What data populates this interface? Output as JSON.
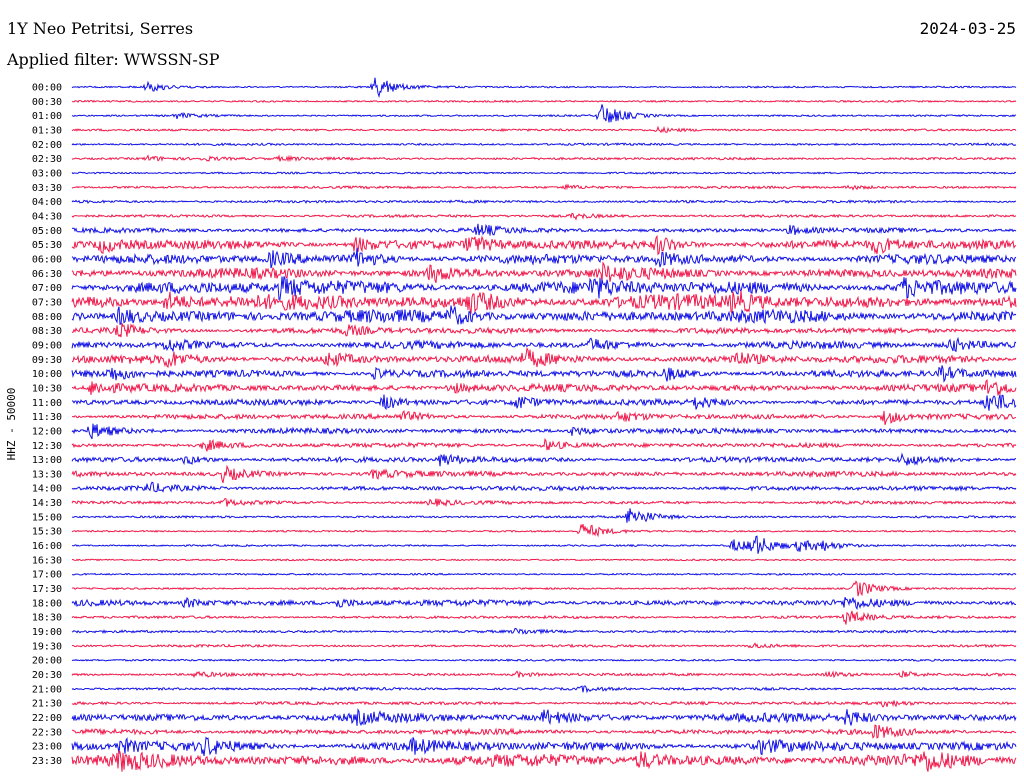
{
  "header": {
    "station": "1Y Neo Petritsi, Serres",
    "date": "2024-03-25",
    "filter": "Applied filter: WWSSN-SP"
  },
  "colors": {
    "even_trace": "#1010e6",
    "odd_trace": "#f0184a",
    "text": "#000000",
    "background": "#ffffff"
  },
  "chart_data": {
    "type": "line",
    "title": "1Y Neo Petritsi, Serres",
    "ylabel": "HHZ - 50000",
    "xlabel": "",
    "grid": false,
    "legend": "none",
    "series": [
      {
        "row_label": "00:00",
        "activity": 0.05,
        "events": [
          [
            0.08,
            1.0
          ],
          [
            0.32,
            2.5
          ]
        ]
      },
      {
        "row_label": "00:30",
        "activity": 0.05,
        "events": []
      },
      {
        "row_label": "01:00",
        "activity": 0.05,
        "events": [
          [
            0.11,
            0.6
          ],
          [
            0.56,
            2.8
          ]
        ]
      },
      {
        "row_label": "01:30",
        "activity": 0.08,
        "events": [
          [
            0.62,
            0.5
          ]
        ]
      },
      {
        "row_label": "02:00",
        "activity": 0.08,
        "events": []
      },
      {
        "row_label": "02:30",
        "activity": 0.1,
        "events": [
          [
            0.08,
            0.5
          ],
          [
            0.14,
            0.4
          ],
          [
            0.22,
            0.4
          ]
        ]
      },
      {
        "row_label": "03:00",
        "activity": 0.06,
        "events": []
      },
      {
        "row_label": "03:30",
        "activity": 0.1,
        "events": [
          [
            0.52,
            0.5
          ],
          [
            0.82,
            0.5
          ]
        ]
      },
      {
        "row_label": "04:00",
        "activity": 0.12,
        "events": []
      },
      {
        "row_label": "04:30",
        "activity": 0.12,
        "events": [
          [
            0.53,
            0.6
          ]
        ]
      },
      {
        "row_label": "05:00",
        "activity": 0.25,
        "events": [
          [
            0.43,
            1.2
          ],
          [
            0.76,
            1.0
          ]
        ]
      },
      {
        "row_label": "05:30",
        "activity": 0.6,
        "events": [
          [
            0.03,
            1.4
          ],
          [
            0.3,
            1.6
          ],
          [
            0.42,
            1.8
          ],
          [
            0.62,
            1.8
          ],
          [
            0.85,
            1.6
          ]
        ]
      },
      {
        "row_label": "06:00",
        "activity": 0.6,
        "events": [
          [
            0.21,
            1.4
          ],
          [
            0.3,
            2.0
          ],
          [
            0.62,
            1.6
          ]
        ]
      },
      {
        "row_label": "06:30",
        "activity": 0.65,
        "events": [
          [
            0.38,
            1.8
          ],
          [
            0.56,
            1.6
          ]
        ]
      },
      {
        "row_label": "07:00",
        "activity": 0.9,
        "events": [
          [
            0.22,
            2.0
          ],
          [
            0.55,
            1.8
          ],
          [
            0.88,
            2.0
          ]
        ]
      },
      {
        "row_label": "07:30",
        "activity": 1.0,
        "events": [
          [
            0.1,
            2.2
          ],
          [
            0.42,
            2.2
          ],
          [
            0.7,
            2.2
          ]
        ]
      },
      {
        "row_label": "08:00",
        "activity": 0.85,
        "events": [
          [
            0.05,
            1.8
          ],
          [
            0.4,
            1.8
          ]
        ]
      },
      {
        "row_label": "08:30",
        "activity": 0.35,
        "events": [
          [
            0.05,
            1.4
          ],
          [
            0.29,
            1.0
          ]
        ]
      },
      {
        "row_label": "09:00",
        "activity": 0.45,
        "events": [
          [
            0.1,
            1.4
          ],
          [
            0.55,
            1.2
          ],
          [
            0.93,
            1.4
          ]
        ]
      },
      {
        "row_label": "09:30",
        "activity": 0.5,
        "events": [
          [
            0.1,
            1.6
          ],
          [
            0.27,
            1.4
          ],
          [
            0.48,
            1.6
          ],
          [
            0.7,
            1.6
          ]
        ]
      },
      {
        "row_label": "10:00",
        "activity": 0.45,
        "events": [
          [
            0.04,
            1.4
          ],
          [
            0.32,
            1.0
          ],
          [
            0.63,
            1.2
          ],
          [
            0.92,
            1.4
          ]
        ]
      },
      {
        "row_label": "10:30",
        "activity": 0.45,
        "events": [
          [
            0.02,
            1.6
          ],
          [
            0.4,
            1.2
          ],
          [
            0.97,
            2.0
          ]
        ]
      },
      {
        "row_label": "11:00",
        "activity": 0.35,
        "events": [
          [
            0.33,
            1.6
          ],
          [
            0.47,
            1.4
          ],
          [
            0.66,
            1.2
          ],
          [
            0.97,
            2.4
          ]
        ]
      },
      {
        "row_label": "11:30",
        "activity": 0.3,
        "events": [
          [
            0.35,
            1.0
          ],
          [
            0.58,
            1.0
          ],
          [
            0.86,
            1.8
          ]
        ]
      },
      {
        "row_label": "12:00",
        "activity": 0.3,
        "events": [
          [
            0.02,
            1.6
          ],
          [
            0.53,
            1.0
          ]
        ]
      },
      {
        "row_label": "12:30",
        "activity": 0.25,
        "events": [
          [
            0.14,
            1.2
          ],
          [
            0.5,
            1.2
          ]
        ]
      },
      {
        "row_label": "13:00",
        "activity": 0.3,
        "events": [
          [
            0.12,
            1.0
          ],
          [
            0.39,
            1.4
          ],
          [
            0.88,
            1.2
          ]
        ]
      },
      {
        "row_label": "13:30",
        "activity": 0.3,
        "events": [
          [
            0.16,
            1.6
          ],
          [
            0.32,
            1.0
          ]
        ]
      },
      {
        "row_label": "14:00",
        "activity": 0.25,
        "events": [
          [
            0.08,
            1.0
          ]
        ]
      },
      {
        "row_label": "14:30",
        "activity": 0.15,
        "events": [
          [
            0.16,
            0.8
          ],
          [
            0.38,
            0.8
          ]
        ]
      },
      {
        "row_label": "15:00",
        "activity": 0.08,
        "events": [
          [
            0.59,
            2.4
          ]
        ]
      },
      {
        "row_label": "15:30",
        "activity": 0.04,
        "events": [
          [
            0.54,
            2.0
          ]
        ]
      },
      {
        "row_label": "16:00",
        "activity": 0.05,
        "events": [
          [
            0.7,
            1.4
          ],
          [
            0.72,
            2.4
          ],
          [
            0.77,
            1.2
          ],
          [
            0.79,
            1.0
          ]
        ]
      },
      {
        "row_label": "16:30",
        "activity": 0.04,
        "events": []
      },
      {
        "row_label": "17:00",
        "activity": 0.05,
        "events": []
      },
      {
        "row_label": "17:30",
        "activity": 0.06,
        "events": [
          [
            0.83,
            2.0
          ]
        ]
      },
      {
        "row_label": "18:00",
        "activity": 0.35,
        "events": [
          [
            0.12,
            1.0
          ],
          [
            0.28,
            1.0
          ],
          [
            0.82,
            1.2
          ]
        ]
      },
      {
        "row_label": "18:30",
        "activity": 0.12,
        "events": [
          [
            0.82,
            1.6
          ]
        ]
      },
      {
        "row_label": "19:00",
        "activity": 0.1,
        "events": [
          [
            0.47,
            0.6
          ]
        ]
      },
      {
        "row_label": "19:30",
        "activity": 0.1,
        "events": [
          [
            0.72,
            0.6
          ]
        ]
      },
      {
        "row_label": "20:00",
        "activity": 0.06,
        "events": []
      },
      {
        "row_label": "20:30",
        "activity": 0.12,
        "events": [
          [
            0.13,
            0.6
          ],
          [
            0.47,
            0.6
          ],
          [
            0.8,
            0.6
          ],
          [
            0.88,
            0.6
          ]
        ]
      },
      {
        "row_label": "21:00",
        "activity": 0.12,
        "events": [
          [
            0.54,
            0.6
          ]
        ]
      },
      {
        "row_label": "21:30",
        "activity": 0.15,
        "events": [
          [
            0.86,
            0.8
          ]
        ]
      },
      {
        "row_label": "22:00",
        "activity": 0.55,
        "events": [
          [
            0.3,
            1.0
          ],
          [
            0.5,
            1.4
          ],
          [
            0.82,
            1.6
          ]
        ]
      },
      {
        "row_label": "22:30",
        "activity": 0.3,
        "events": [
          [
            0.85,
            1.4
          ]
        ]
      },
      {
        "row_label": "23:00",
        "activity": 0.6,
        "events": [
          [
            0.05,
            1.4
          ],
          [
            0.14,
            1.6
          ],
          [
            0.36,
            1.2
          ],
          [
            0.73,
            1.4
          ]
        ]
      },
      {
        "row_label": "23:30",
        "activity": 0.8,
        "events": [
          [
            0.05,
            1.6
          ],
          [
            0.6,
            1.8
          ],
          [
            0.9,
            1.8
          ]
        ]
      }
    ]
  }
}
